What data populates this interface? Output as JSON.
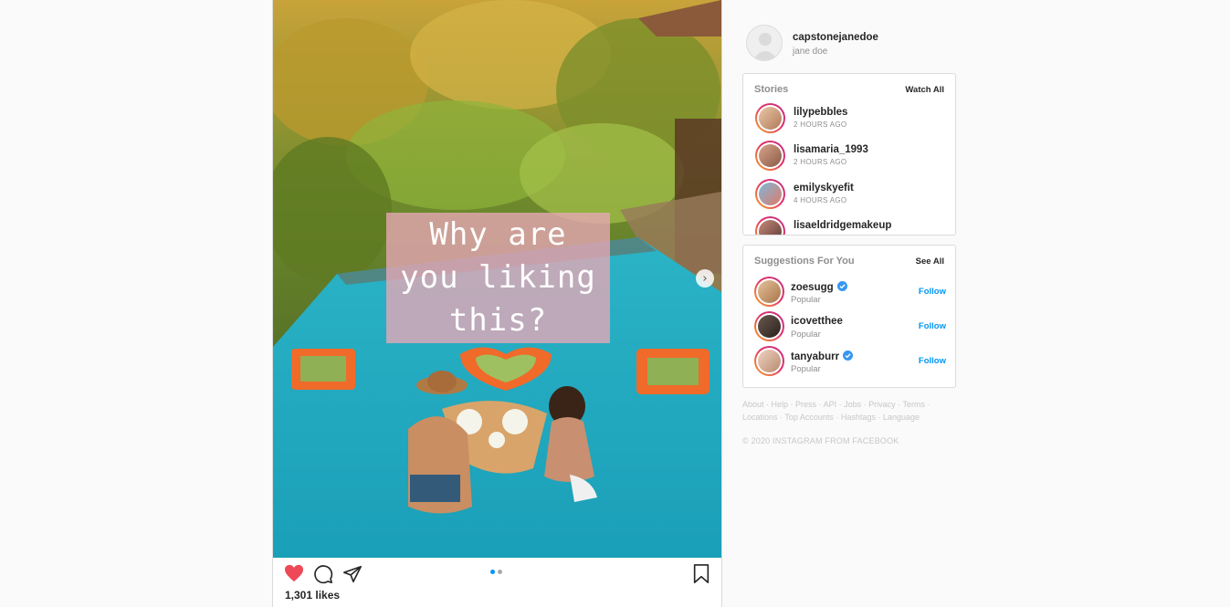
{
  "post": {
    "overlay_text": "Why are\nyou liking\nthis?",
    "likes": "1,301 likes",
    "carousel": {
      "count": 2,
      "active": 0
    }
  },
  "profile": {
    "username": "capstonejanedoe",
    "name": "jane doe"
  },
  "stories": {
    "title": "Stories",
    "watch_all": "Watch All",
    "items": [
      {
        "username": "lilypebbles",
        "time": "2 HOURS AGO"
      },
      {
        "username": "lisamaria_1993",
        "time": "2 HOURS AGO"
      },
      {
        "username": "emilyskyefit",
        "time": "4 HOURS AGO"
      },
      {
        "username": "lisaeldridgemakeup",
        "time": ""
      }
    ]
  },
  "suggestions": {
    "title": "Suggestions For You",
    "see_all": "See All",
    "items": [
      {
        "username": "zoesugg",
        "subtitle": "Popular",
        "verified": true,
        "action": "Follow"
      },
      {
        "username": "icovetthee",
        "subtitle": "Popular",
        "verified": false,
        "action": "Follow"
      },
      {
        "username": "tanyaburr",
        "subtitle": "Popular",
        "verified": true,
        "action": "Follow"
      }
    ]
  },
  "footer": {
    "links": [
      "About",
      "Help",
      "Press",
      "API",
      "Jobs",
      "Privacy",
      "Terms",
      "Locations",
      "Top Accounts",
      "Hashtags",
      "Language"
    ],
    "copyright": "© 2020 INSTAGRAM FROM FACEBOOK"
  },
  "colors": {
    "like_red": "#ed4956",
    "link_blue": "#0095f6",
    "overlay_pink": "#e8a8b6"
  }
}
